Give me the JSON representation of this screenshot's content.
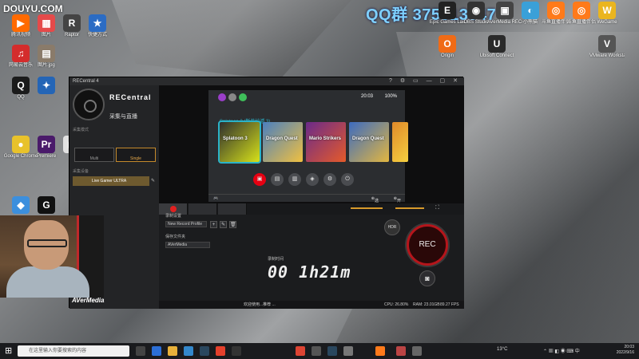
{
  "overlay": {
    "watermark": "DOUYU.COM",
    "qq_group": "QQ群 375513947"
  },
  "desktop_icons_left": [
    {
      "label": "腾讯视频",
      "color": "#ff6a00",
      "glyph": "▶"
    },
    {
      "label": "图片",
      "color": "#e54a4a",
      "glyph": "▦"
    },
    {
      "label": "Raptor",
      "color": "#444",
      "glyph": "R"
    },
    {
      "label": "快捷方式",
      "color": "#2b6cc4",
      "glyph": "★"
    },
    {
      "label": "网易云音乐",
      "color": "#d42c2c",
      "glyph": "♫"
    },
    {
      "label": "图片.jpg",
      "color": "#8a7b6a",
      "glyph": "▤"
    },
    {
      "label": "QQ",
      "color": "#1b1b1b",
      "glyph": "Q"
    },
    {
      "label": "",
      "color": "#2465b6",
      "glyph": "✦"
    },
    {
      "label": "Google Chrome",
      "color": "#e8c22b",
      "glyph": "●"
    },
    {
      "label": "Premiere",
      "color": "#4a1a6a",
      "glyph": "Pr"
    },
    {
      "label": "",
      "color": "#e2e2e2",
      "glyph": "▢"
    },
    {
      "label": "",
      "color": "#3c8fdd",
      "glyph": "◆"
    },
    {
      "label": "",
      "color": "#111",
      "glyph": "G"
    }
  ],
  "desktop_icons_right": [
    {
      "label": "Epic Games Launcher",
      "color": "#222",
      "glyph": "E"
    },
    {
      "label": "OBS Studio",
      "color": "#333",
      "glyph": "◉"
    },
    {
      "label": "AVerMedia RECentral 4",
      "color": "#444",
      "glyph": "▣"
    },
    {
      "label": "小熊猫",
      "color": "#3aa0d8",
      "glyph": "◐"
    },
    {
      "label": "斗鱼直播伴侣",
      "color": "#ff7a1a",
      "glyph": "◎"
    },
    {
      "label": "斗鱼直播伴侣",
      "color": "#ff7a1a",
      "glyph": "◎"
    },
    {
      "label": "WeGame",
      "color": "#eab51f",
      "glyph": "W"
    },
    {
      "label": "Origin",
      "color": "#f06b16",
      "glyph": "O"
    },
    {
      "label": "Ubisoft Connect",
      "color": "#2a2a2a",
      "glyph": "U"
    },
    {
      "label": "VMware Workstation",
      "color": "#555",
      "glyph": "V"
    }
  ],
  "window": {
    "title": "RECentral 4",
    "controls": "? ⚙ ▭ — ▢ ✕",
    "brand": "RECentral",
    "mode_title": "采集与直播",
    "section_mode": "采集模式",
    "mode_btn_multi": "Multi",
    "mode_btn_single": "Single",
    "section_device": "采集设备",
    "device_name": "Live Gamer ULTRA"
  },
  "switch": {
    "time": "20:03",
    "battery": "100",
    "game_title": "Splatoon 3 (斯普拉遁 3)",
    "tiles": [
      {
        "name": "Splatoon 3",
        "color": "#2e2e2e",
        "accent": "#d7e21a"
      },
      {
        "name": "Dragon Quest",
        "color": "#4b7fbf",
        "accent": "#f0c040"
      },
      {
        "name": "Mario Strikers",
        "color": "#6a2a8a",
        "accent": "#e55a2a"
      },
      {
        "name": "Dragon Quest",
        "color": "#3c6bc0",
        "accent": "#e2b640"
      },
      {
        "name": "",
        "color": "#e08a2a",
        "accent": "#f5d040"
      }
    ],
    "nav_icons": [
      "news-icon",
      "eshop-icon",
      "album-icon",
      "controllers-icon",
      "settings-icon",
      "power-icon"
    ],
    "bottom_options": "选项",
    "bottom_start": "开始"
  },
  "record": {
    "settings_label": "录制设置",
    "profile_value": "New Record Profile",
    "save_folder_label": "保存文件夹",
    "folder_value": "AVerMedia",
    "timer_label": "录制时间",
    "timer": "00 1h21m",
    "hdr": "HDR",
    "rec": "REC"
  },
  "statusbar": {
    "hint": "欢迎使用...推荐 ...",
    "cpu": "CPU: 26.80%",
    "ram": "RAM: 23.01GB",
    "fps": "89.27 FPS"
  },
  "brand_footer": "AVerMedia",
  "taskbar": {
    "search_placeholder": "在这里输入你要搜索的内容",
    "weather": "13°C",
    "time": "20:03",
    "date": "2022/9/16"
  }
}
